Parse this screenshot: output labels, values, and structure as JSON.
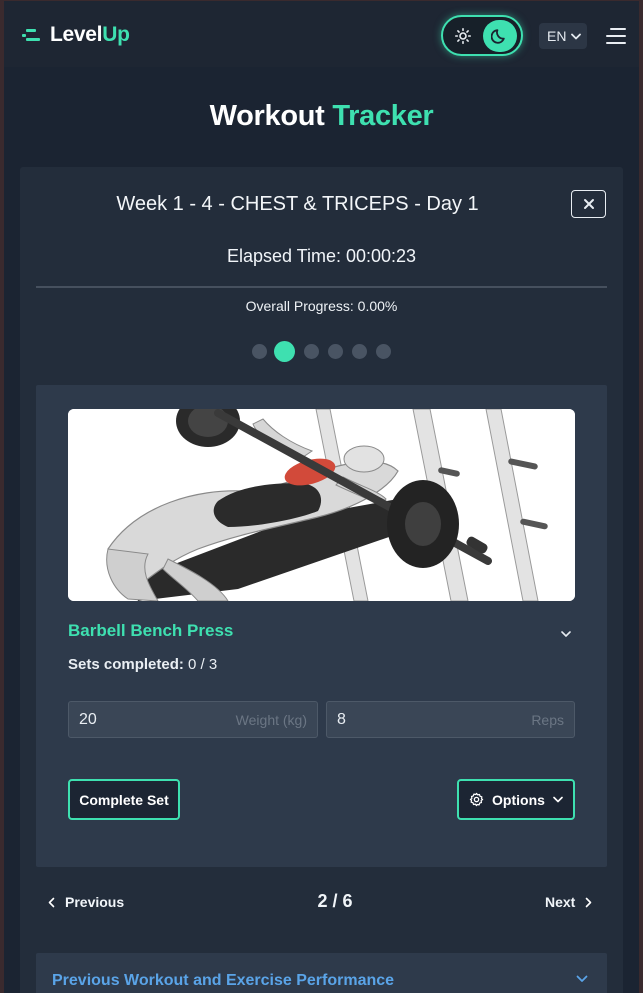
{
  "header": {
    "logo_part1": "Level",
    "logo_part2": "Up",
    "theme_light_icon": "sun-icon",
    "theme_dark_icon": "moon-icon",
    "language": "EN",
    "menu_icon": "menu-icon"
  },
  "page": {
    "title_part1": "Workout",
    "title_part2": "Tracker"
  },
  "workout": {
    "name": "Week 1 - 4 - CHEST & TRICEPS - Day 1",
    "elapsed": "Elapsed Time: 00:00:23",
    "overall_progress": "Overall Progress: 0.00%",
    "exercise_count": 6,
    "current_exercise_index": 2
  },
  "exercise": {
    "name": "Barbell Bench Press",
    "sets_label": "Sets completed:",
    "sets_value": "0 / 3",
    "weight_value": "20",
    "weight_placeholder": "Weight (kg)",
    "reps_value": "8",
    "reps_placeholder": "Reps",
    "complete_button": "Complete Set",
    "options_button": "Options"
  },
  "pager": {
    "previous": "Previous",
    "position": "2 / 6",
    "next": "Next"
  },
  "history": {
    "title": "Previous Workout and Exercise Performance"
  },
  "colors": {
    "accent": "#3ee0b0",
    "background": "#1b2432",
    "card": "#232d3b",
    "panel": "#2e3a4b",
    "link_blue": "#5aa4e8"
  }
}
